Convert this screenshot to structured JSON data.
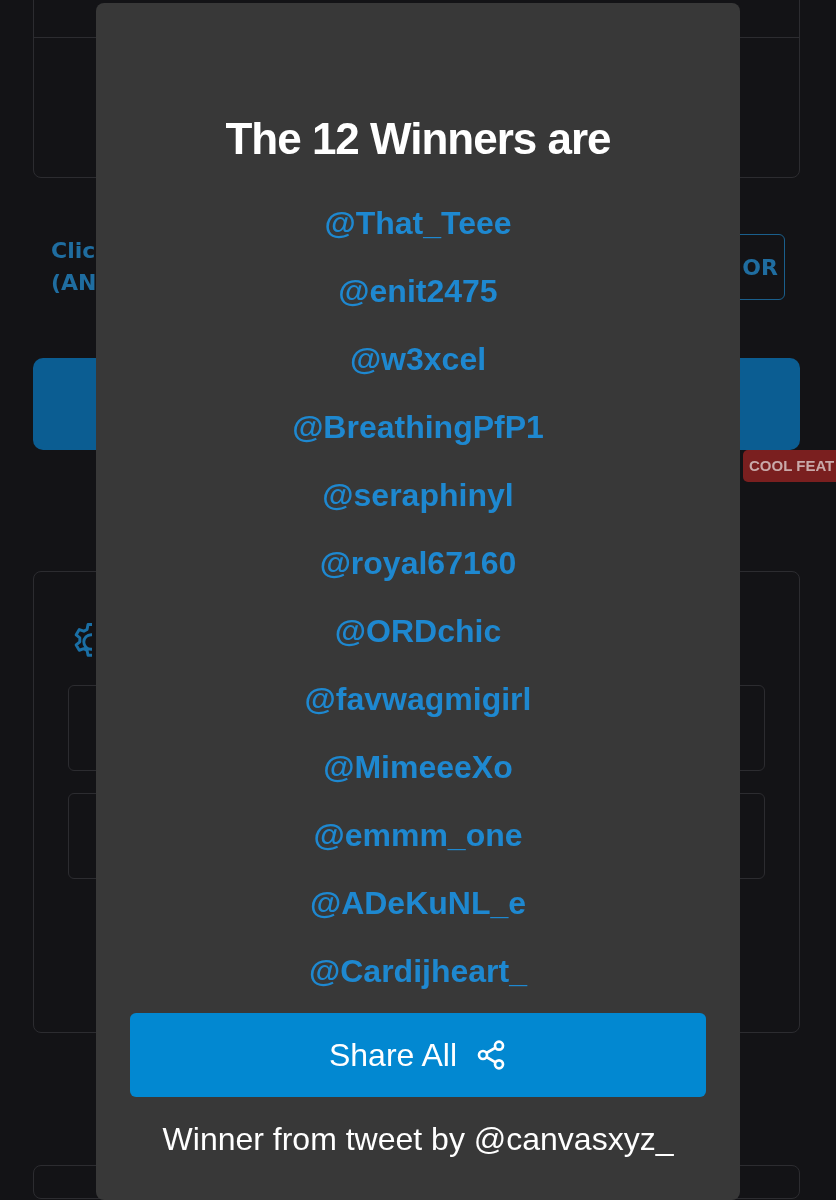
{
  "background": {
    "hint_lines": [
      "Clic",
      "(AN"
    ],
    "side_button": "OR",
    "badge": "COOL FEAT"
  },
  "modal": {
    "title": "The 12 Winners are",
    "winners": [
      "@That_Teee",
      "@enit2475",
      "@w3xcel",
      "@BreathingPfP1",
      "@seraphinyl",
      "@royal67160",
      "@ORDchic",
      "@favwagmigirl",
      "@MimeeeXo",
      "@emmm_one",
      "@ADeKuNL_e",
      "@Cardijheart_"
    ],
    "share_button": "Share All",
    "footer": "Winner from tweet by @canvasxyz_"
  }
}
